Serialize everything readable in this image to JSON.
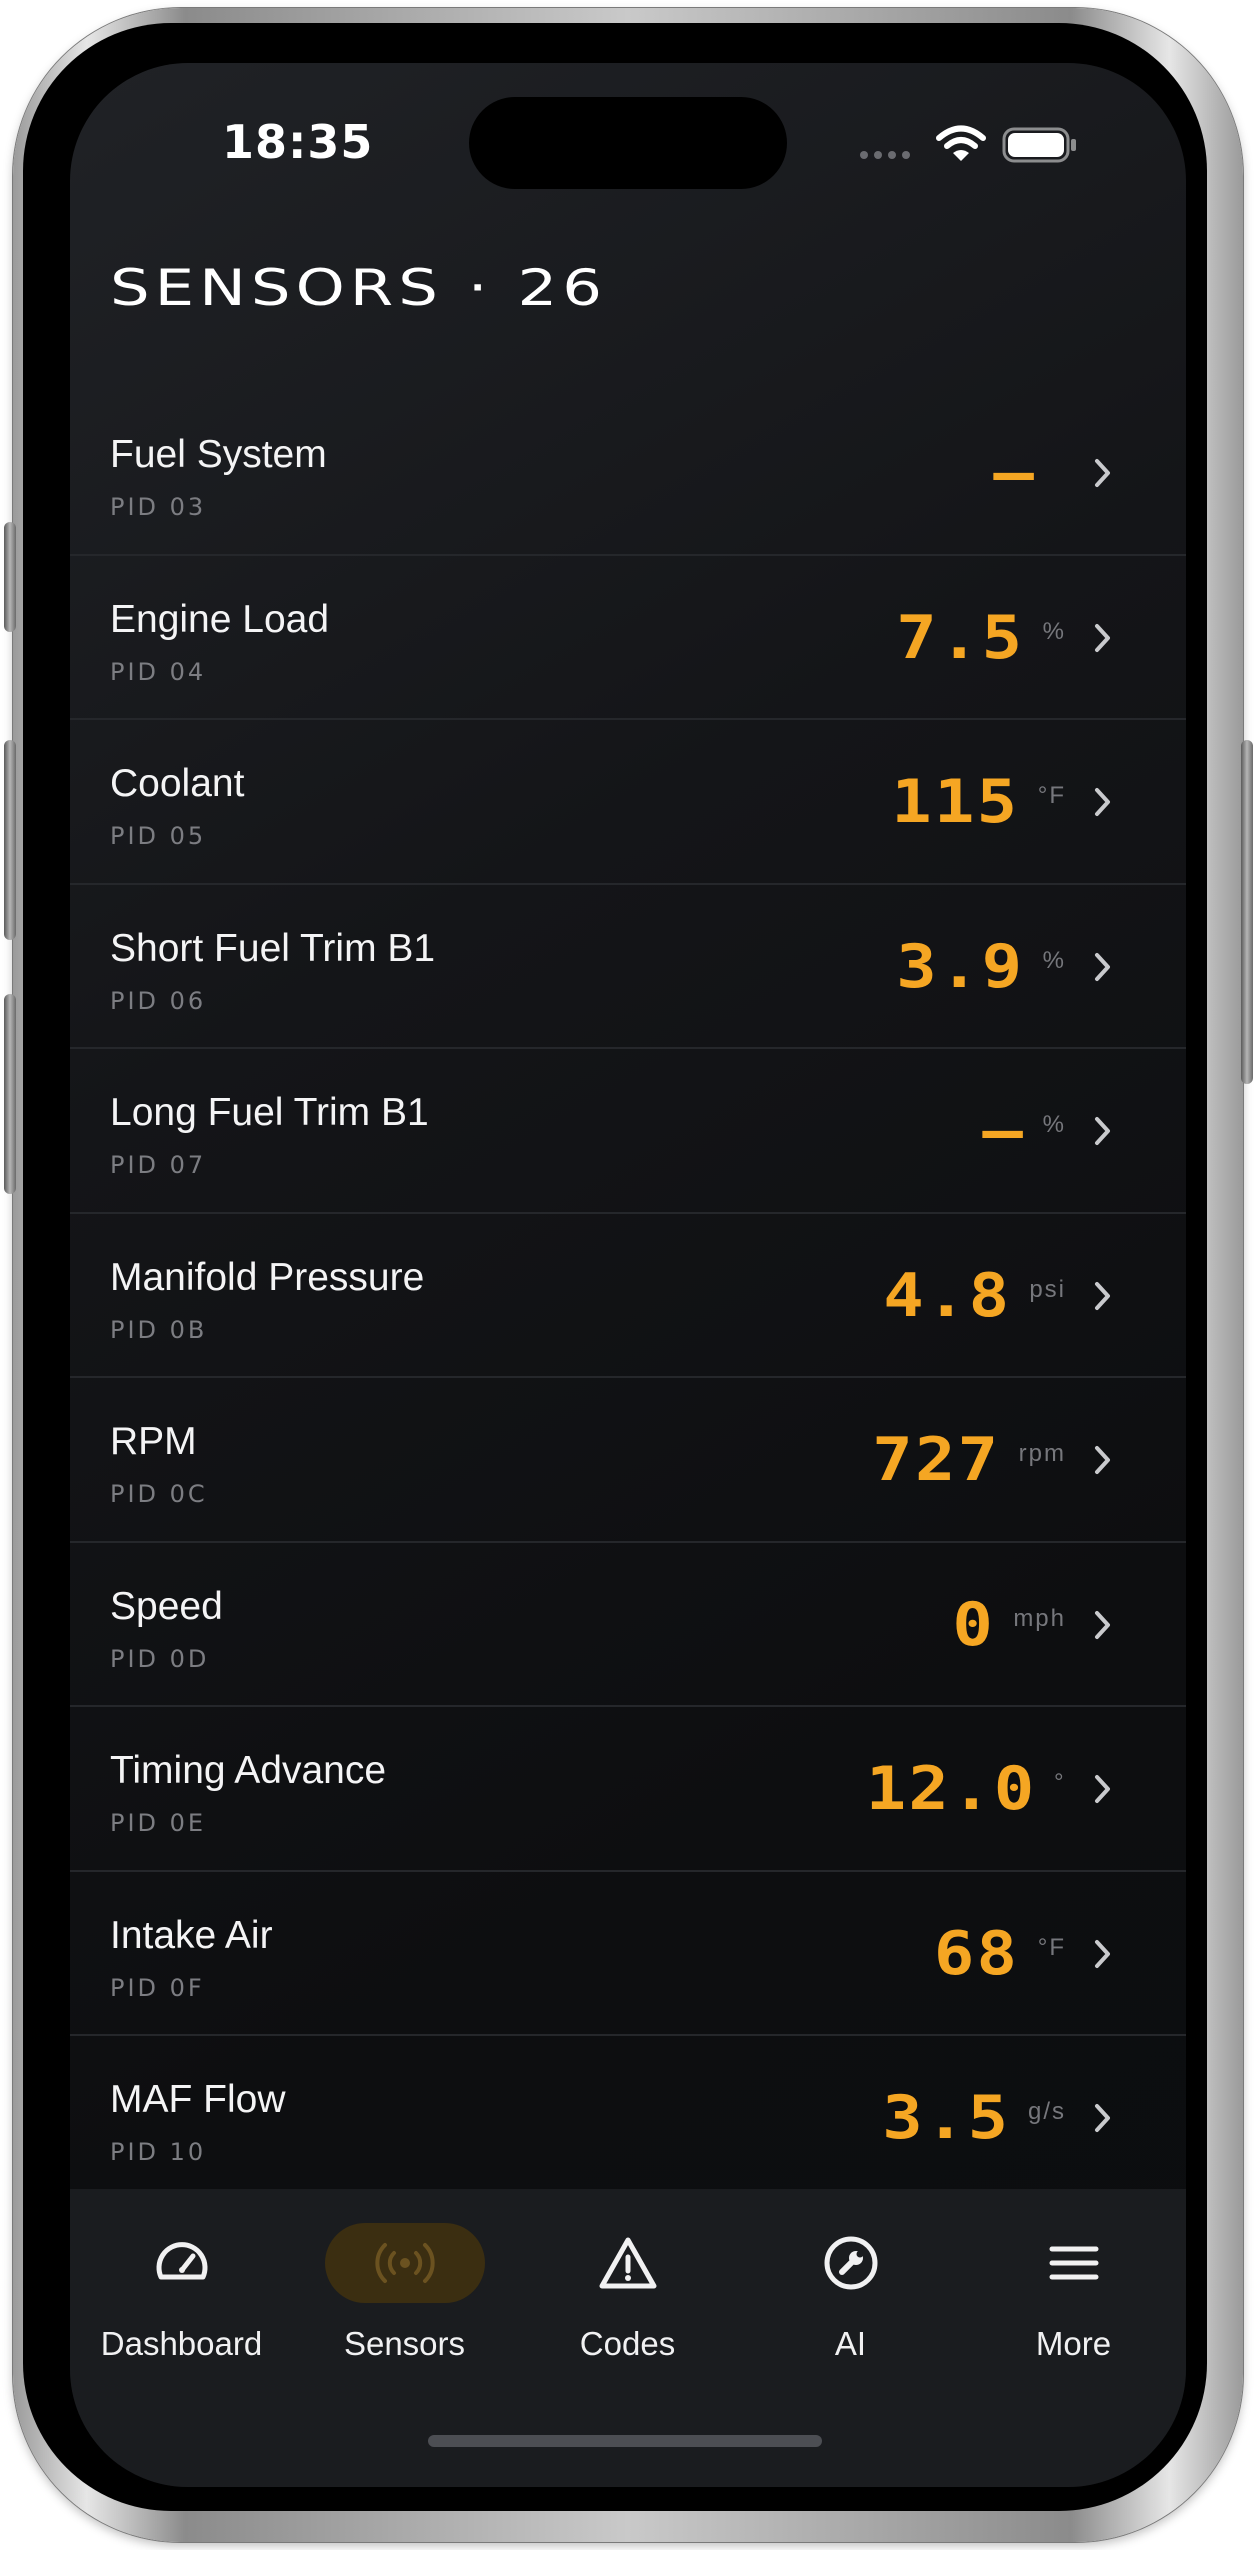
{
  "status_bar": {
    "time": "18:35"
  },
  "header": {
    "title": "SENSORS · 26"
  },
  "sensors": [
    {
      "name": "Fuel System",
      "pid": "PID 03",
      "value": "—",
      "unit": ""
    },
    {
      "name": "Engine Load",
      "pid": "PID 04",
      "value": "7.5",
      "unit": "%"
    },
    {
      "name": "Coolant",
      "pid": "PID 05",
      "value": "115",
      "unit": "°F"
    },
    {
      "name": "Short Fuel Trim B1",
      "pid": "PID 06",
      "value": "3.9",
      "unit": "%"
    },
    {
      "name": "Long Fuel Trim B1",
      "pid": "PID 07",
      "value": "—",
      "unit": "%"
    },
    {
      "name": "Manifold Pressure",
      "pid": "PID 0B",
      "value": "4.8",
      "unit": "psi"
    },
    {
      "name": "RPM",
      "pid": "PID 0C",
      "value": "727",
      "unit": "rpm"
    },
    {
      "name": "Speed",
      "pid": "PID 0D",
      "value": "0",
      "unit": "mph"
    },
    {
      "name": "Timing Advance",
      "pid": "PID 0E",
      "value": "12.0",
      "unit": "°"
    },
    {
      "name": "Intake Air",
      "pid": "PID 0F",
      "value": "68",
      "unit": "°F"
    },
    {
      "name": "MAF Flow",
      "pid": "PID 10",
      "value": "3.5",
      "unit": "g/s"
    }
  ],
  "tab_bar": {
    "tabs": [
      {
        "label": "Dashboard",
        "icon": "gauge-icon",
        "active": false
      },
      {
        "label": "Sensors",
        "icon": "broadcast-icon",
        "active": true
      },
      {
        "label": "Codes",
        "icon": "warning-triangle-icon",
        "active": false
      },
      {
        "label": "AI",
        "icon": "wrench-circle-icon",
        "active": false
      },
      {
        "label": "More",
        "icon": "hamburger-menu-icon",
        "active": false
      }
    ]
  },
  "colors": {
    "accent": "#f5a623",
    "background": "#0f1013",
    "tab_bar_bg": "#1a1c1f",
    "active_tab_pill": "#3b2e11",
    "divider": "#25272b",
    "secondary_text": "#7c7d82"
  }
}
